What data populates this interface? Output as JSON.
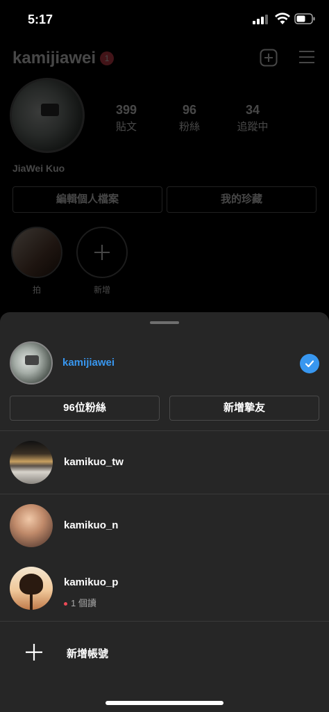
{
  "status_bar": {
    "time": "5:17"
  },
  "profile": {
    "username": "kamijiawei",
    "notification_count": "1",
    "stats": [
      {
        "num": "399",
        "label": "貼文"
      },
      {
        "num": "96",
        "label": "粉絲"
      },
      {
        "num": "34",
        "label": "追蹤中"
      }
    ],
    "full_name": "JiaWei Kuo",
    "edit_profile_label": "編輯個人檔案",
    "saved_label": "我的珍藏",
    "highlights": [
      {
        "label": "拍"
      },
      {
        "label": "新增"
      }
    ]
  },
  "sheet": {
    "current_account": "kamijiawei",
    "followers_button": "96位粉絲",
    "add_close_friends_button": "新增摯友",
    "accounts": [
      {
        "name": "kamikuo_tw"
      },
      {
        "name": "kamikuo_n"
      },
      {
        "name": "kamikuo_p",
        "unread": "1 個讀"
      }
    ],
    "add_account_label": "新增帳號"
  },
  "colors": {
    "accent": "#3897f0",
    "sheet_bg": "#262626",
    "badge": "#ed4956"
  }
}
